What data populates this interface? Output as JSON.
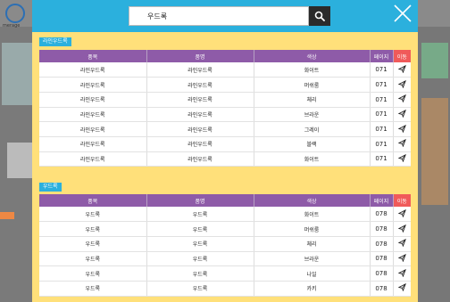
{
  "background": {
    "logo_text": "merage"
  },
  "search": {
    "query": "우드록"
  },
  "headers": {
    "col_item": "품목",
    "col_product": "품명",
    "col_color": "색상",
    "col_page": "페이지",
    "col_file": "이동"
  },
  "sections": [
    {
      "label": "라인우드록",
      "rows": [
        {
          "item": "라인우드록",
          "product": "라인우드록",
          "color": "화이트",
          "page": "071"
        },
        {
          "item": "라인우드록",
          "product": "라인우드록",
          "color": "머쉬룸",
          "page": "071"
        },
        {
          "item": "라인우드록",
          "product": "라인우드록",
          "color": "체리",
          "page": "071"
        },
        {
          "item": "라인우드록",
          "product": "라인우드록",
          "color": "브라운",
          "page": "071"
        },
        {
          "item": "라인우드록",
          "product": "라인우드록",
          "color": "그레이",
          "page": "071"
        },
        {
          "item": "라인우드록",
          "product": "라인우드록",
          "color": "블랙",
          "page": "071"
        },
        {
          "item": "라인우드록",
          "product": "라인우드록",
          "color": "화이트",
          "page": "071"
        }
      ]
    },
    {
      "label": "우드록",
      "rows": [
        {
          "item": "우드록",
          "product": "우드록",
          "color": "화이트",
          "page": "078"
        },
        {
          "item": "우드록",
          "product": "우드록",
          "color": "머쉬룸",
          "page": "078"
        },
        {
          "item": "우드록",
          "product": "우드록",
          "color": "체리",
          "page": "078"
        },
        {
          "item": "우드록",
          "product": "우드록",
          "color": "브라운",
          "page": "078"
        },
        {
          "item": "우드록",
          "product": "우드록",
          "color": "나일",
          "page": "078"
        },
        {
          "item": "우드록",
          "product": "우드록",
          "color": "카키",
          "page": "078"
        }
      ]
    }
  ],
  "colors": {
    "header_bar": "#2bb0dd",
    "modal_bg": "#ffe07a",
    "table_header": "#8e5ba8",
    "file_header": "#f05a5a"
  },
  "icons": {
    "search": "search-icon",
    "close": "close-icon",
    "send": "send-icon"
  }
}
